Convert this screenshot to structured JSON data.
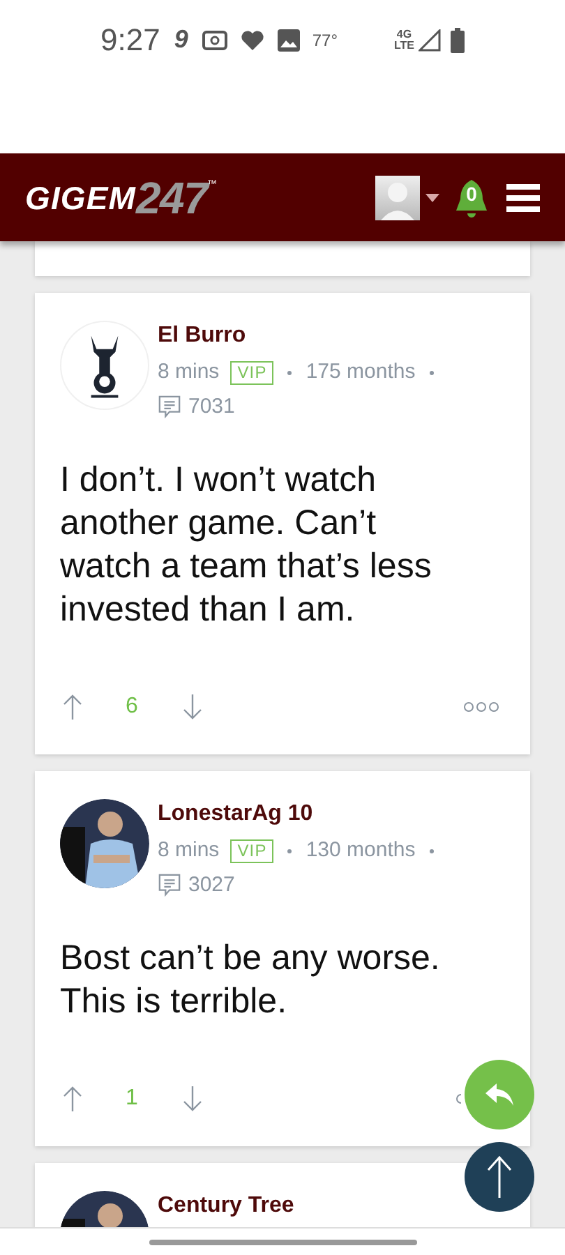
{
  "status_bar": {
    "time": "9:27",
    "notification_glyph": "9",
    "temperature": "77°",
    "network": "4G",
    "network_sub": "LTE"
  },
  "header": {
    "logo_main": "GIGEM",
    "logo_number": "247",
    "logo_mark": "™",
    "notification_count": "0"
  },
  "posts": [
    {
      "author": "El Burro",
      "kind": "logo-avatar",
      "time": "8 mins",
      "badge": "VIP",
      "tenure": "175 months",
      "post_count": "7031",
      "body": "I don’t. I won’t watch another game. Can’t watch a team that’s less invested than I am.",
      "votes": "6",
      "more_icon_covered": false
    },
    {
      "author": "LonestarAg 10",
      "kind": "photo-avatar",
      "time": "8 mins",
      "badge": "VIP",
      "tenure": "130 months",
      "post_count": "3027",
      "body": "Bost can’t be any worse. This is terrible.",
      "votes": "1",
      "more_icon_covered": true
    },
    {
      "author": "Century Tree",
      "kind": "photo-avatar"
    }
  ]
}
